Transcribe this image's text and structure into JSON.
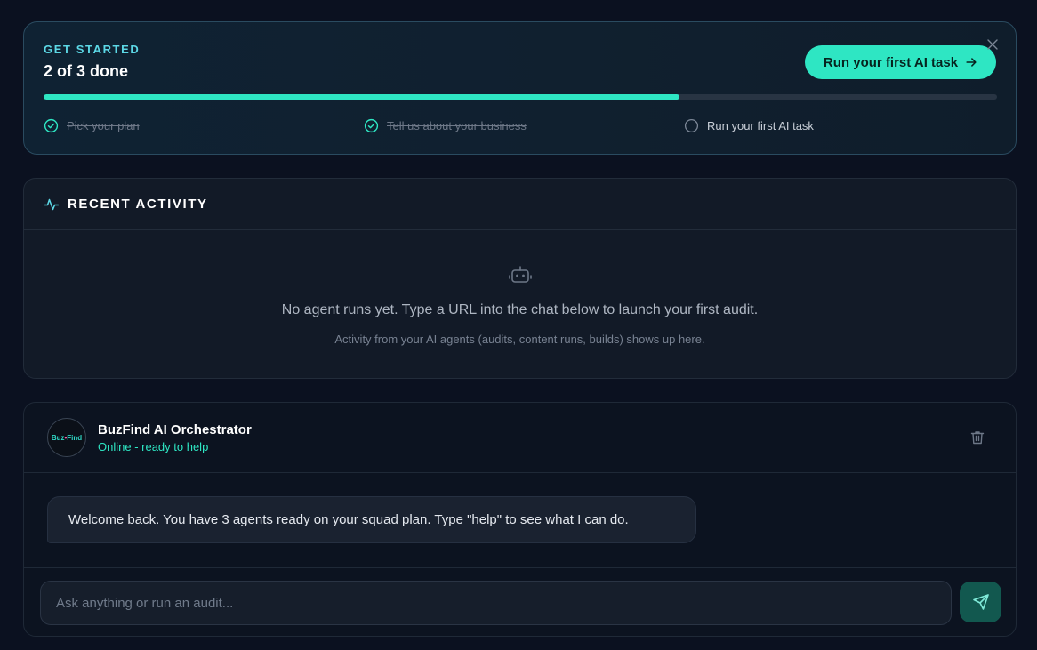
{
  "onboarding": {
    "eyebrow": "GET STARTED",
    "progress_text": "2 of 3 done",
    "progress_fraction": 0.6667,
    "cta_label": "Run your first AI task",
    "cta_icon": "arrow-right-icon",
    "close_icon": "close-icon",
    "steps": [
      {
        "label": "Pick your plan",
        "done": true,
        "icon": "check-circle-icon"
      },
      {
        "label": "Tell us about your business",
        "done": true,
        "icon": "check-circle-icon"
      },
      {
        "label": "Run your first AI task",
        "done": false,
        "icon": "empty-circle-icon"
      }
    ]
  },
  "activity": {
    "title": "RECENT ACTIVITY",
    "title_icon": "activity-pulse-icon",
    "empty_icon": "robot-icon",
    "empty_message": "No agent runs yet. Type a URL into the chat below to launch your first audit.",
    "empty_subtext": "Activity from your AI agents (audits, content runs, builds) shows up here."
  },
  "chat": {
    "avatar_text_left": "Buz",
    "avatar_text_right": "Find",
    "agent_name": "BuzFind AI Orchestrator",
    "agent_status": "Online - ready to help",
    "trash_icon": "trash-icon",
    "messages": [
      {
        "role": "assistant",
        "text": "Welcome back. You have 3 agents ready on your squad plan. Type \"help\" to see what I can do."
      }
    ],
    "input_value": "",
    "input_placeholder": "Ask anything or run an audit...",
    "send_icon": "send-icon"
  },
  "colors": {
    "accent": "#2ee6c3",
    "eyebrow": "#5cd8e6",
    "background": "#0b1120",
    "card": "#121a27"
  }
}
